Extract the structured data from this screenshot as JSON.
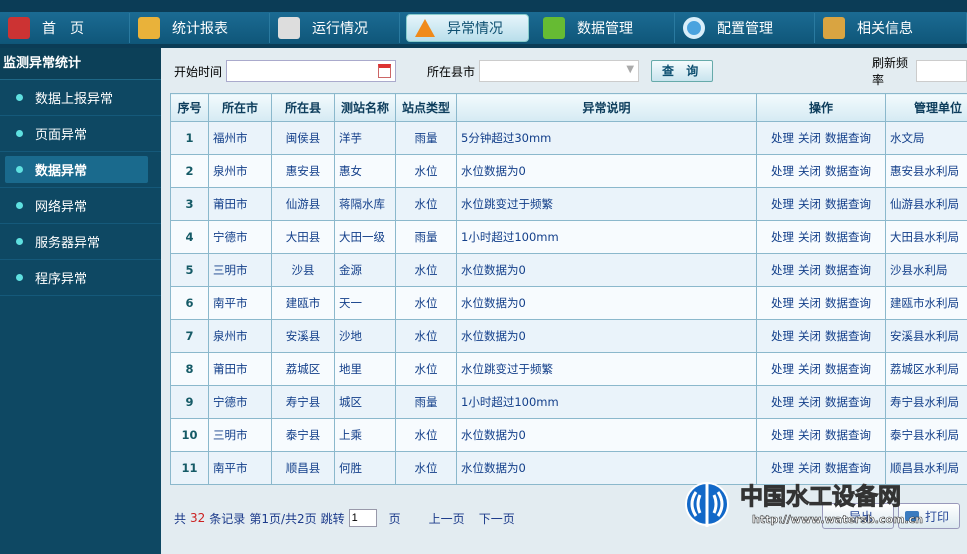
{
  "nav": [
    {
      "label": "首　页",
      "icon": "home-icon",
      "color": "#c33"
    },
    {
      "label": "统计报表",
      "icon": "report-icon",
      "color": "#e9b23a"
    },
    {
      "label": "运行情况",
      "icon": "document-icon",
      "color": "#ddd"
    },
    {
      "label": "异常情况",
      "icon": "warning-icon",
      "color": "#f08a1a"
    },
    {
      "label": "数据管理",
      "icon": "database-icon",
      "color": "#6b3"
    },
    {
      "label": "配置管理",
      "icon": "gear-icon",
      "color": "#4aa3df"
    },
    {
      "label": "相关信息",
      "icon": "clipboard-icon",
      "color": "#d9a441"
    }
  ],
  "nav_active": 3,
  "sidebar": {
    "title": "监测异常统计",
    "items": [
      "数据上报异常",
      "页面异常",
      "数据异常",
      "网络异常",
      "服务器异常",
      "程序异常"
    ],
    "active": 2
  },
  "filter": {
    "start_label": "开始时间",
    "start_value": "",
    "county_label": "所在县市",
    "county_value": "",
    "query": "查 询",
    "refresh_label": "刷新频率",
    "refresh_value": ""
  },
  "table": {
    "headers": [
      "序号",
      "所在市",
      "所在县",
      "测站名称",
      "站点类型",
      "异常说明",
      "操作",
      "管理单位"
    ],
    "actions": [
      "处理",
      "关闭",
      "数据查询"
    ],
    "rows": [
      [
        "1",
        "福州市",
        "闽侯县",
        "洋芋",
        "雨量",
        "5分钟超过30mm",
        "水文局"
      ],
      [
        "2",
        "泉州市",
        "惠安县",
        "惠女",
        "水位",
        "水位数据为0",
        "惠安县水利局"
      ],
      [
        "3",
        "莆田市",
        "仙游县",
        "蒋隔水库",
        "水位",
        "水位跳变过于频繁",
        "仙游县水利局"
      ],
      [
        "4",
        "宁德市",
        "大田县",
        "大田一级",
        "雨量",
        "1小时超过100mm",
        "大田县水利局"
      ],
      [
        "5",
        "三明市",
        "沙县",
        "金源",
        "水位",
        "水位数据为0",
        "沙县水利局"
      ],
      [
        "6",
        "南平市",
        "建瓯市",
        "天一",
        "水位",
        "水位数据为0",
        "建瓯市水利局"
      ],
      [
        "7",
        "泉州市",
        "安溪县",
        "沙地",
        "水位",
        "水位数据为0",
        "安溪县水利局"
      ],
      [
        "8",
        "莆田市",
        "荔城区",
        "地里",
        "水位",
        "水位跳变过于频繁",
        "荔城区水利局"
      ],
      [
        "9",
        "宁德市",
        "寿宁县",
        "城区",
        "雨量",
        "1小时超过100mm",
        "寿宁县水利局"
      ],
      [
        "10",
        "三明市",
        "泰宁县",
        "上乘",
        "水位",
        "水位数据为0",
        "泰宁县水利局"
      ],
      [
        "11",
        "南平市",
        "顺昌县",
        "何胜",
        "水位",
        "水位数据为0",
        "顺昌县水利局"
      ]
    ]
  },
  "pager": {
    "prefix": "共",
    "total": "32",
    "suffix": "条记录",
    "page_info": "第1页/共2页",
    "jump": "跳转",
    "page_value": "1",
    "page_unit": "页",
    "prev": "上一页",
    "next": "下一页",
    "export": "导出",
    "print": "打印"
  },
  "watermark": {
    "name": "中国水工设备网",
    "url": "http://www.watersb.com.cn"
  }
}
